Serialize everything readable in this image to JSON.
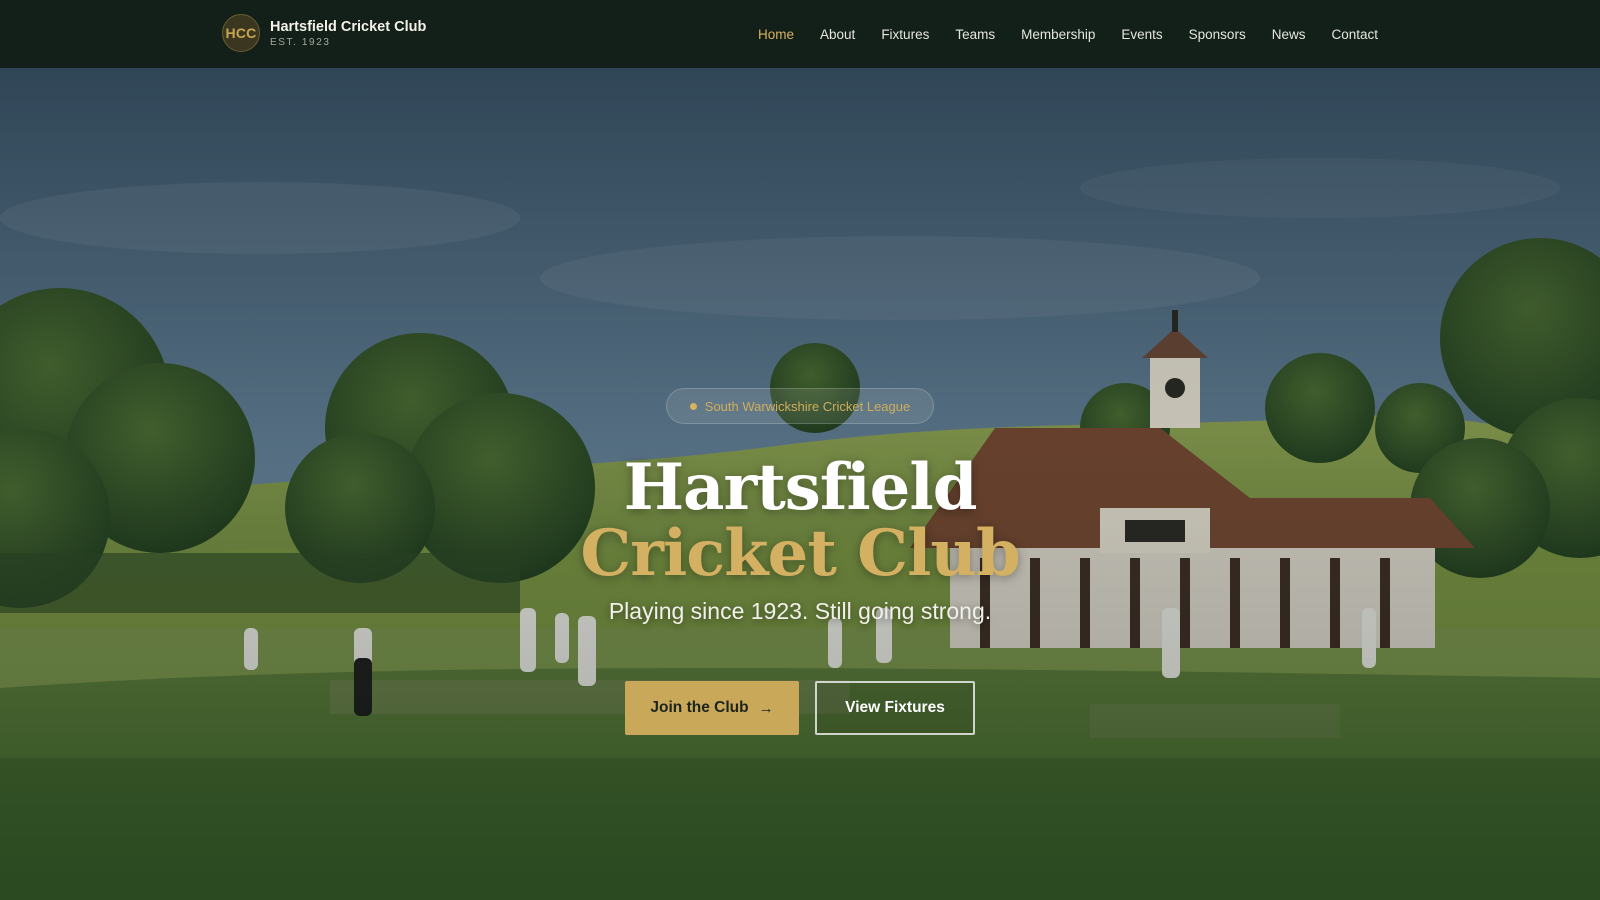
{
  "header": {
    "logo_text": "HCC",
    "club_name": "Hartsfield Cricket Club",
    "est": "EST. 1923",
    "nav": [
      {
        "label": "Home",
        "active": true
      },
      {
        "label": "About"
      },
      {
        "label": "Fixtures"
      },
      {
        "label": "Teams"
      },
      {
        "label": "Membership"
      },
      {
        "label": "Events"
      },
      {
        "label": "Sponsors"
      },
      {
        "label": "News"
      },
      {
        "label": "Contact"
      }
    ]
  },
  "hero": {
    "league_badge": "South Warwickshire Cricket League",
    "title_line1": "Hartsfield",
    "title_line2": "Cricket Club",
    "tagline": "Playing since 1923. Still going strong.",
    "primary_button": {
      "label": "Join the Club",
      "icon": "arrow-right-icon"
    },
    "secondary_button": {
      "label": "View Fixtures"
    }
  },
  "colors": {
    "topbar": "#122019",
    "accent_gold": "#c9a85a",
    "active_nav": "#d6b25c"
  }
}
